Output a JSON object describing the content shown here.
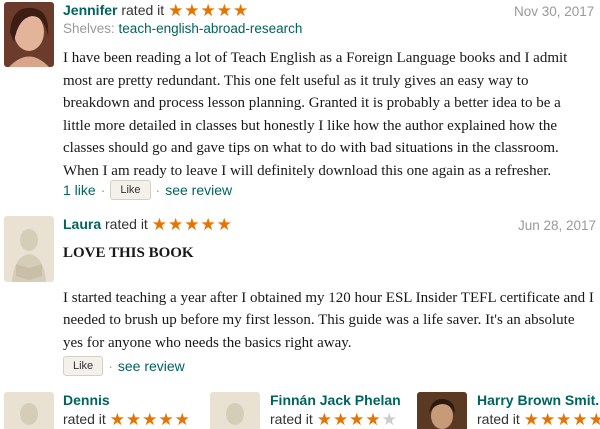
{
  "reviews": [
    {
      "user": "Jennifer",
      "rated_text": "rated it",
      "stars": "★★★★★",
      "date": "Nov 30, 2017",
      "shelves_label": "Shelves:",
      "shelf": "teach-english-abroad-research",
      "paragraphs": [
        "I have been reading a lot of Teach English as a Foreign Language books and I admit most are pretty redundant. This one felt useful as it truly gives an easy way to breakdown and process lesson planning. Granted it is probably a better idea to be a little more detailed in classes but honestly I like how the author explained how the classes should go and gave tips on what to do with bad situations in the classroom. When I am ready to leave I will definitely download this one again as a refresher."
      ],
      "likes": "1 like",
      "like_label": "Like",
      "see_review": "see review"
    },
    {
      "user": "Laura",
      "rated_text": "rated it",
      "stars": "★★★★★",
      "date": "Jun 28, 2017",
      "heading": "LOVE THIS BOOK",
      "paragraphs": [
        "I started teaching a year after I obtained my 120 hour ESL Insider TEFL certificate and I needed to brush up before my first lesson. This guide was a life saver. It's an absolute yes for anyone who needs the basics right away."
      ],
      "like_label": "Like",
      "see_review": "see review"
    }
  ],
  "friends": [
    {
      "name": "Dennis",
      "rated_text": "rated it",
      "stars": "★★★★★",
      "empty": ""
    },
    {
      "name": "Finnán Jack Phelan",
      "rated_text": "rated it",
      "stars": "★★★★",
      "empty": "★"
    },
    {
      "name": "Harry Brown Smit...",
      "rated_text": "rated it",
      "stars": "★★★★★",
      "empty": ""
    }
  ],
  "separator": "·",
  "colors": {
    "link": "#00635d",
    "star": "#e87400",
    "muted": "#999999",
    "button_bg": "#f4f1ea"
  }
}
